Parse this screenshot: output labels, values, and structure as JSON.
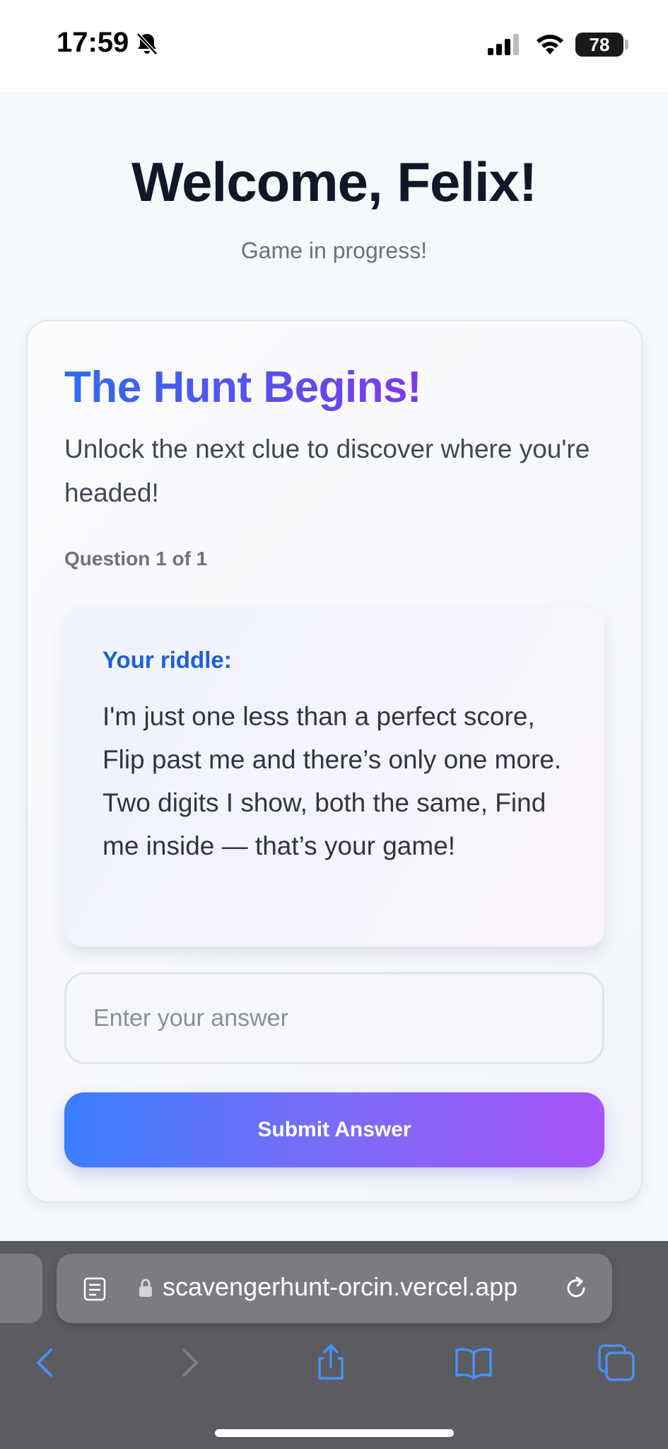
{
  "status_bar": {
    "time": "17:59",
    "battery": "78",
    "icons": [
      "bell-slash-icon",
      "signal-icon",
      "wifi-icon",
      "battery-icon"
    ]
  },
  "page": {
    "title": "Welcome, Felix!",
    "subtitle": "Game in progress!"
  },
  "card": {
    "title": "The Hunt Begins!",
    "description": "Unlock the next clue to discover where you're headed!",
    "question_counter": "Question 1 of 1",
    "riddle_label": "Your riddle:",
    "riddle_text": "I'm just one less than a perfect score, Flip past me and there’s only one more. Two digits I show, both the same, Find me inside — that’s your game!",
    "answer_placeholder": "Enter your answer",
    "answer_value": "",
    "submit_label": "Submit Answer"
  },
  "browser": {
    "url": "scavengerhunt-orcin.vercel.app",
    "icons": [
      "reader-icon",
      "lock-icon",
      "reload-icon",
      "back-icon",
      "forward-icon",
      "share-icon",
      "bookmarks-icon",
      "tabs-icon"
    ]
  },
  "colors": {
    "title_gradient_start": "#2f6bf0",
    "title_gradient_end": "#7c3aed",
    "riddle_label": "#1d5fd9",
    "button_gradient_start": "#3a7dfd",
    "button_gradient_end": "#a855f7",
    "toolbar_blue": "#4a90f5"
  }
}
